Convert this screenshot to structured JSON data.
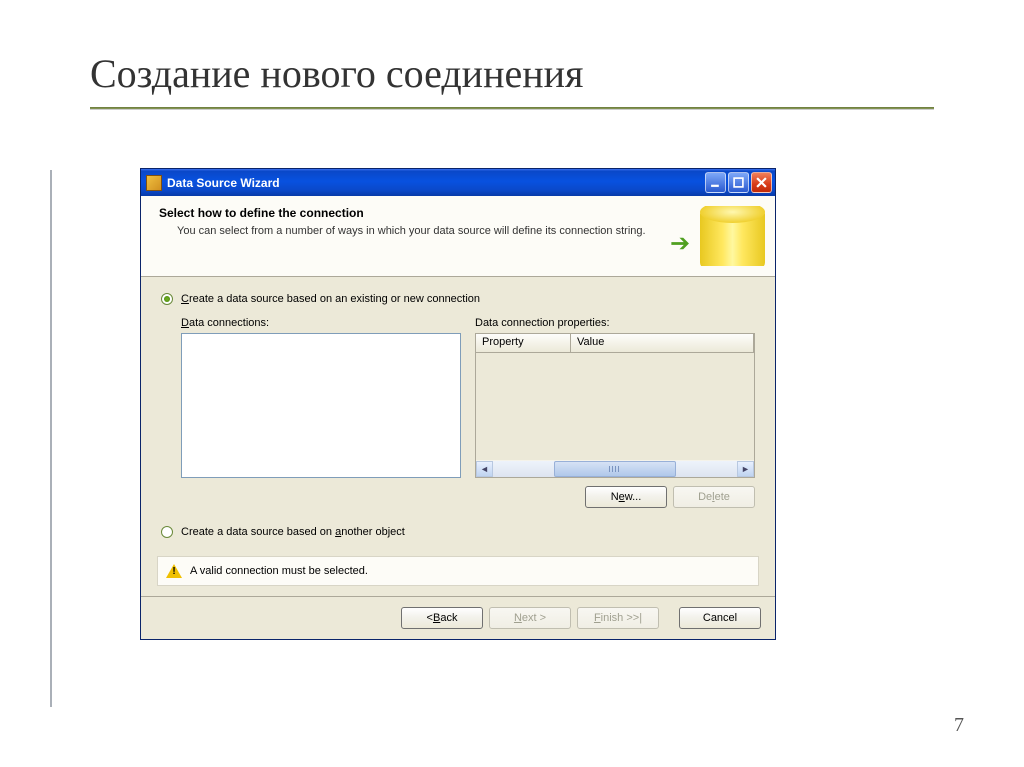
{
  "slide": {
    "title": "Создание нового соединения",
    "page_number": "7"
  },
  "window": {
    "title": "Data Source Wizard"
  },
  "header": {
    "title": "Select how to define the connection",
    "subtitle": "You can select from a number of ways in which your data source will define its connection string."
  },
  "options": {
    "opt1_text": "Create a data source based on an existing or new connection",
    "opt2_text": "Create a data source based on another object"
  },
  "labels": {
    "data_connections": "Data connections:",
    "data_connection_properties": "Data connection properties:",
    "property_col": "Property",
    "value_col": "Value"
  },
  "buttons": {
    "new": "New...",
    "delete": "Delete",
    "back": "< Back",
    "next": "Next >",
    "finish": "Finish >>|",
    "cancel": "Cancel"
  },
  "validation": {
    "message": "A valid connection must be selected."
  }
}
